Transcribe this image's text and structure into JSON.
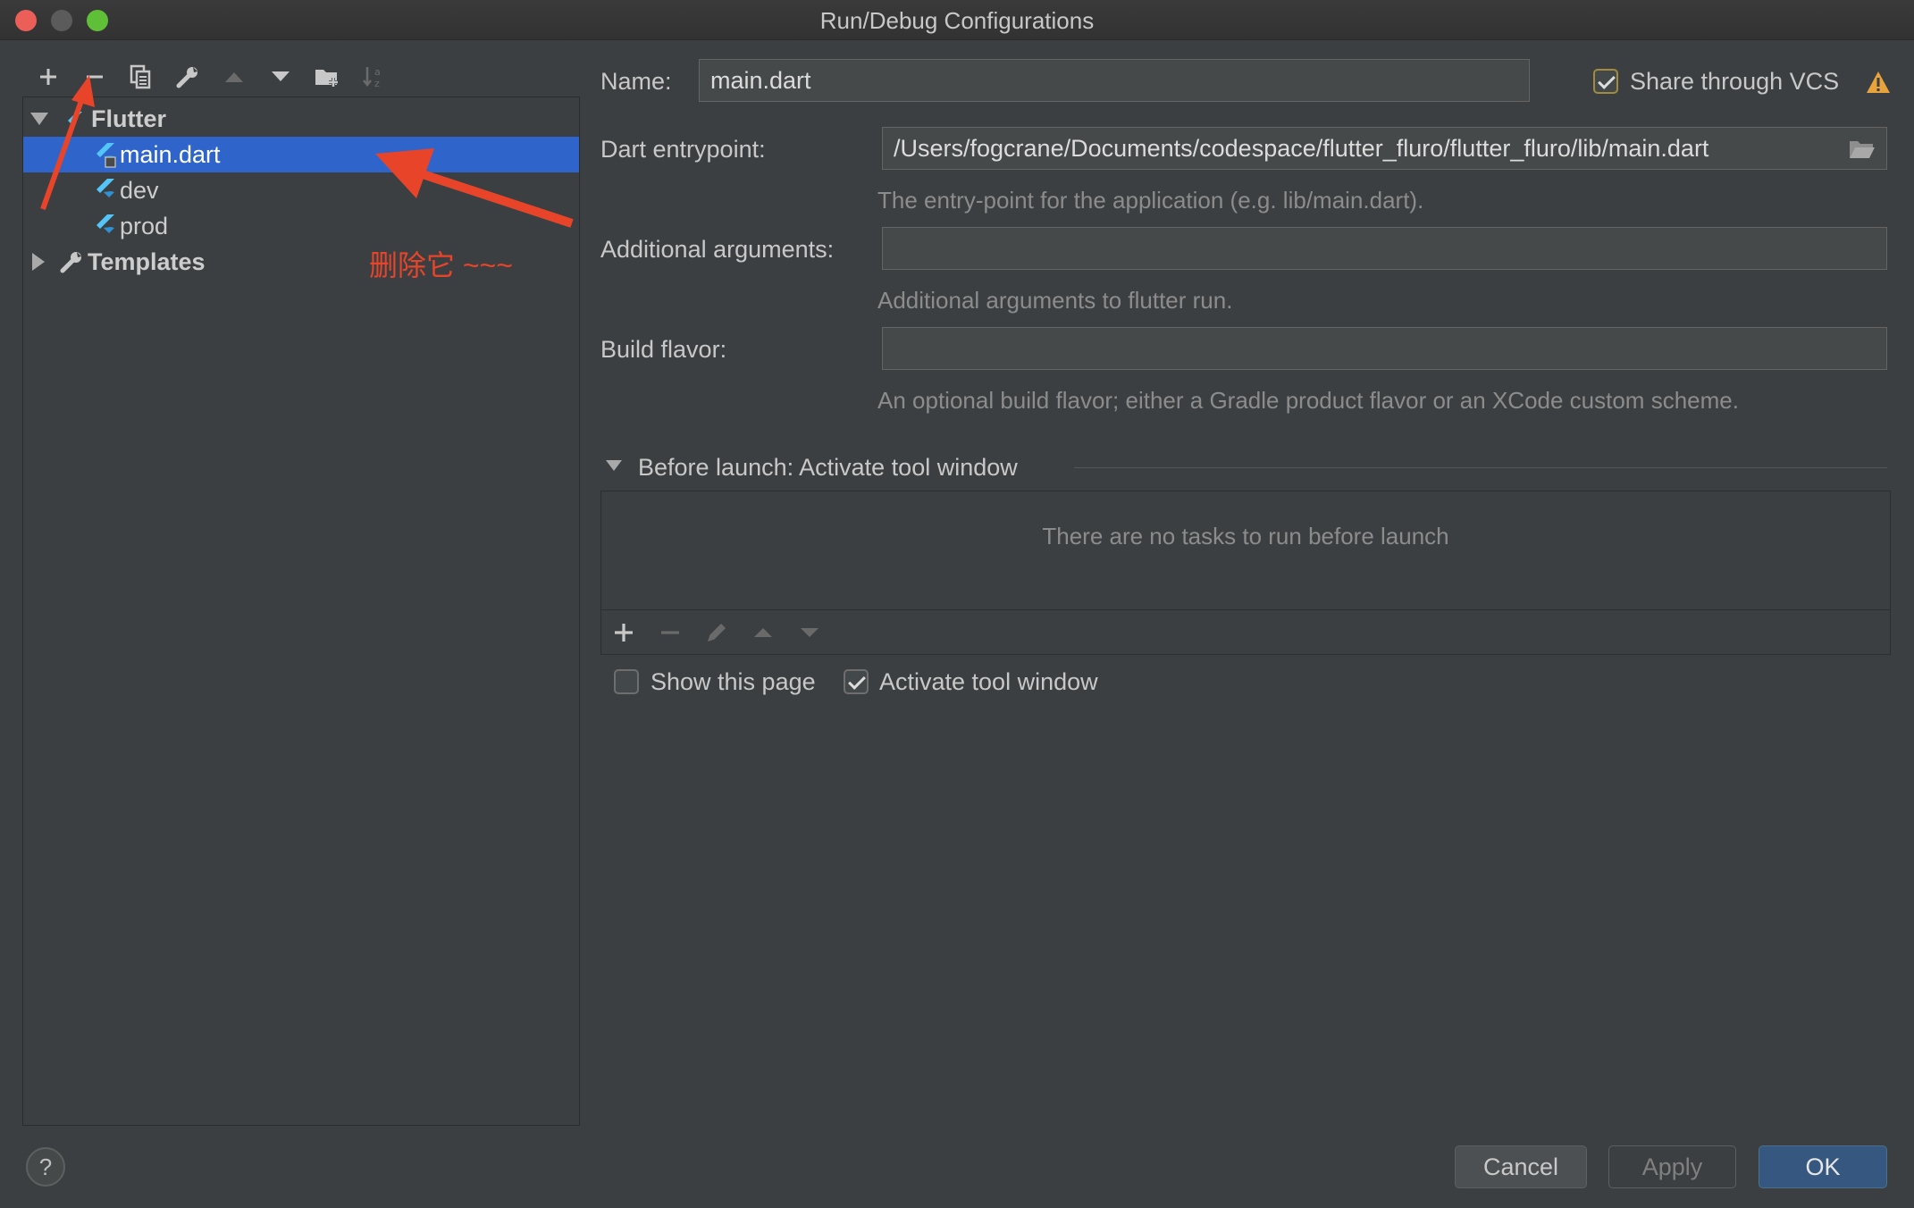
{
  "window": {
    "title": "Run/Debug Configurations"
  },
  "toolbar": {
    "icons": [
      "add-icon",
      "remove-icon",
      "copy-icon",
      "wrench-icon",
      "move-up-icon",
      "move-down-icon",
      "new-folder-icon",
      "sort-icon"
    ]
  },
  "tree": {
    "group": "Flutter",
    "items": [
      "main.dart",
      "dev",
      "prod"
    ],
    "templates": "Templates"
  },
  "annotation": {
    "text": "删除它 ~~~",
    "color": "#e8442a"
  },
  "form": {
    "name_label": "Name:",
    "name_value": "main.dart",
    "share_label": "Share through VCS",
    "share_checked": true,
    "entry_label": "Dart entrypoint:",
    "entry_value": "/Users/fogcrane/Documents/codespace/flutter_fluro/flutter_fluro/lib/main.dart",
    "entry_hint": "The entry-point for the application (e.g. lib/main.dart).",
    "args_label": "Additional arguments:",
    "args_value": "",
    "args_hint": "Additional arguments to flutter run.",
    "flavor_label": "Build flavor:",
    "flavor_value": "",
    "flavor_hint": "An optional build flavor; either a Gradle product flavor or an XCode custom scheme."
  },
  "before_launch": {
    "title": "Before launch: Activate tool window",
    "empty": "There are no tasks to run before launch",
    "show_page_label": "Show this page",
    "show_page_checked": false,
    "activate_label": "Activate tool window",
    "activate_checked": true
  },
  "buttons": {
    "cancel": "Cancel",
    "apply": "Apply",
    "ok": "OK",
    "help": "?"
  },
  "colors": {
    "selection": "#2f65ca",
    "background": "#3c3f41",
    "primary": "#365880",
    "flutter": "#54c5f8"
  }
}
